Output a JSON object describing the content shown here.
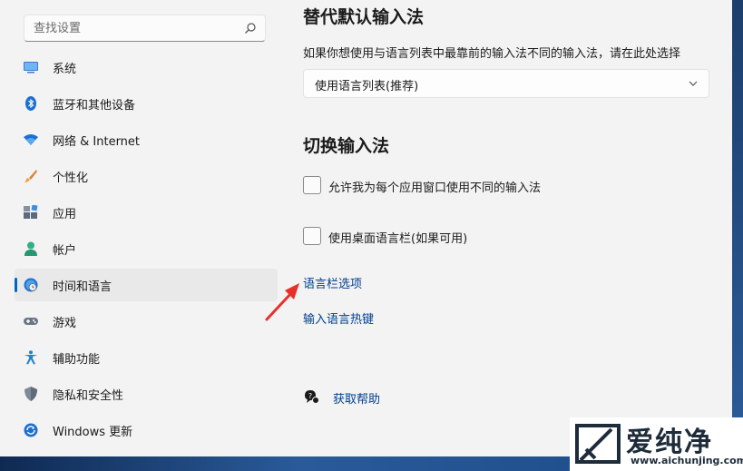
{
  "search": {
    "placeholder": "查找设置"
  },
  "sidebar": {
    "items": [
      {
        "label": "系统",
        "icon": "monitor-icon"
      },
      {
        "label": "蓝牙和其他设备",
        "icon": "bluetooth-icon"
      },
      {
        "label": "网络 & Internet",
        "icon": "wifi-icon"
      },
      {
        "label": "个性化",
        "icon": "brush-icon"
      },
      {
        "label": "应用",
        "icon": "apps-icon"
      },
      {
        "label": "帐户",
        "icon": "person-icon"
      },
      {
        "label": "时间和语言",
        "icon": "globe-clock-icon",
        "active": true
      },
      {
        "label": "游戏",
        "icon": "gamepad-icon"
      },
      {
        "label": "辅助功能",
        "icon": "accessibility-icon"
      },
      {
        "label": "隐私和安全性",
        "icon": "shield-icon"
      },
      {
        "label": "Windows 更新",
        "icon": "update-icon"
      }
    ]
  },
  "main": {
    "section1_title": "替代默认输入法",
    "section1_desc": "如果你想使用与语言列表中最靠前的输入法不同的输入法，请在此处选择",
    "select_value": "使用语言列表(推荐)",
    "section2_title": "切换输入法",
    "checkbox1_label": "允许我为每个应用窗口使用不同的输入法",
    "checkbox2_label": "使用桌面语言栏(如果可用)",
    "link_langbar": "语言栏选项",
    "link_hotkeys": "输入语言热键",
    "help_label": "获取帮助"
  },
  "watermark": {
    "brand": "爱纯净",
    "url": "www.aichunjing.com"
  },
  "colors": {
    "accent": "#0067c0",
    "link": "#003e92",
    "arrow": "#e8302a"
  }
}
